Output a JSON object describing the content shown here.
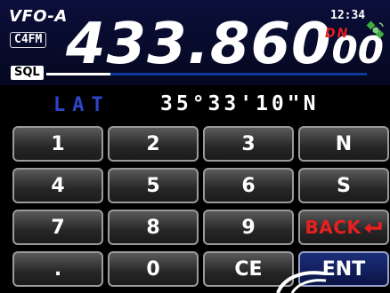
{
  "header": {
    "vfo_label": "VFO-A",
    "mode_badge": "C4FM",
    "time": "12:34",
    "freq_main": "433.860",
    "freq_small": "00",
    "dn_label": "DN",
    "sql_label": "SQL",
    "sql_level": 0.2
  },
  "entry": {
    "label": "LAT",
    "value": "35°33'10\"N"
  },
  "keypad": {
    "keys": [
      "1",
      "2",
      "3",
      "N",
      "4",
      "5",
      "6",
      "S",
      "7",
      "8",
      "9",
      "BACK",
      ".",
      "0",
      "CE",
      "ENT"
    ]
  },
  "colors": {
    "header_bg": "#0b0f3a",
    "label_blue": "#2d45c8",
    "back_red": "#e8201f",
    "dn_red": "#e31f1f"
  }
}
